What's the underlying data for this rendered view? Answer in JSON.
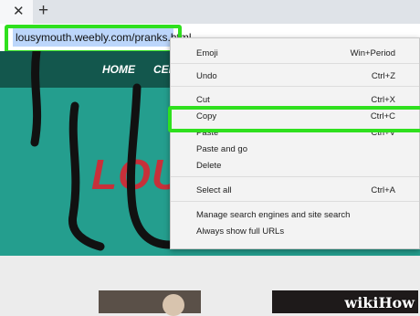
{
  "browser": {
    "new_tab_label": "+",
    "close_tab_label": "✕",
    "url": "lousymouth.weebly.com/pranks.html"
  },
  "site": {
    "nav": [
      "HOME",
      "CEL"
    ],
    "logo_text": "LOU"
  },
  "context_menu": {
    "items": [
      {
        "label": "Emoji",
        "shortcut": "Win+Period"
      },
      {
        "label": "Undo",
        "shortcut": "Ctrl+Z"
      },
      {
        "label": "Cut",
        "shortcut": "Ctrl+X"
      },
      {
        "label": "Copy",
        "shortcut": "Ctrl+C"
      },
      {
        "label": "Paste",
        "shortcut": "Ctrl+V"
      },
      {
        "label": "Paste and go",
        "shortcut": ""
      },
      {
        "label": "Delete",
        "shortcut": ""
      },
      {
        "label": "Select all",
        "shortcut": "Ctrl+A"
      },
      {
        "label": "Manage search engines and site search",
        "shortcut": ""
      },
      {
        "label": "Always show full URLs",
        "shortcut": ""
      }
    ]
  },
  "watermark": "wikiHow",
  "colors": {
    "callout": "#2fe01e",
    "site_teal": "#249e8e",
    "logo_red": "#c7303a"
  }
}
